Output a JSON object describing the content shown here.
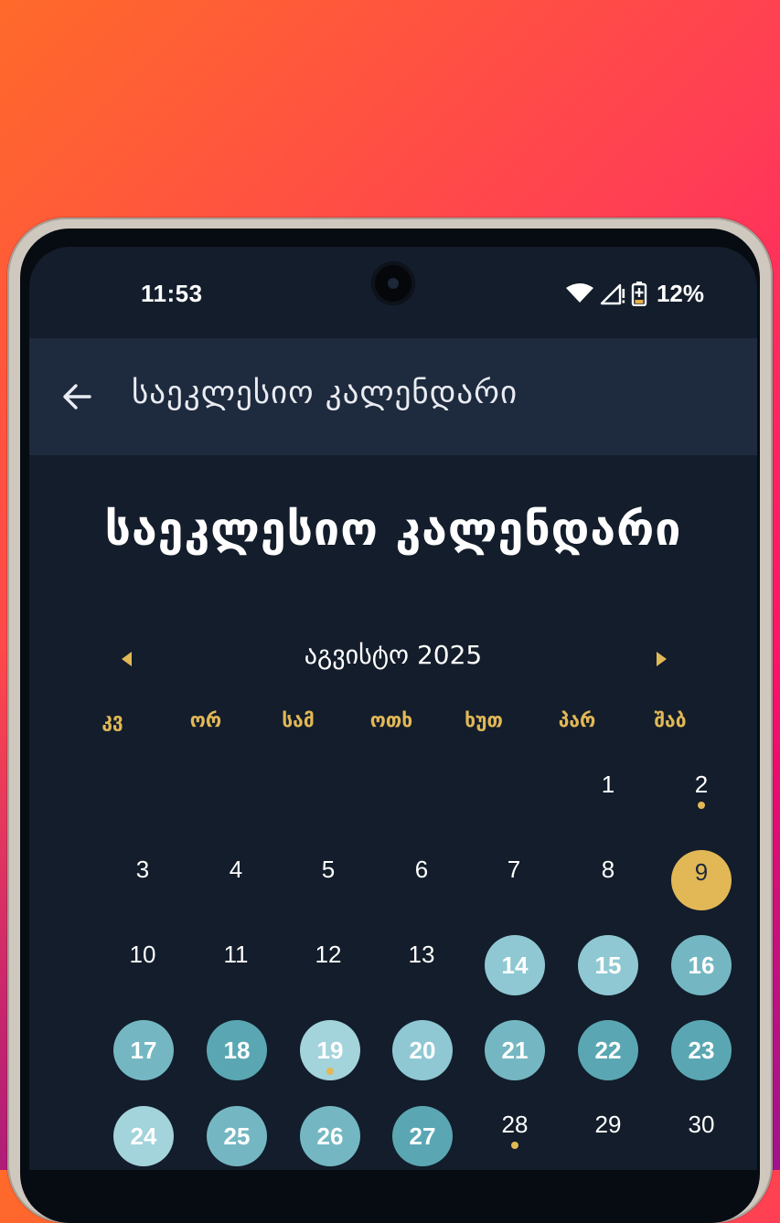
{
  "status_bar": {
    "time": "11:53",
    "battery": "12%",
    "icons": [
      "wifi-icon",
      "cellular-no-signal-icon",
      "battery-charging-icon"
    ]
  },
  "app_bar": {
    "back_icon": "arrow-left-icon",
    "title": "საეკლესიო კალენდარი"
  },
  "page": {
    "title": "საეკლესიო კალენდარი"
  },
  "calendar": {
    "month_label": "აგვისტო 2025",
    "prev_icon": "caret-left-icon",
    "next_icon": "caret-right-icon",
    "weekdays": [
      "კვ",
      "ორ",
      "სამ",
      "ოთხ",
      "ხუთ",
      "პარ",
      "შაბ"
    ],
    "days": [
      "1",
      "2",
      "3",
      "4",
      "5",
      "6",
      "7",
      "8",
      "9",
      "10",
      "11",
      "12",
      "13",
      "14",
      "15",
      "16",
      "17",
      "18",
      "19",
      "20",
      "21",
      "22",
      "23",
      "24",
      "25",
      "26",
      "27",
      "28",
      "29",
      "30"
    ],
    "selected_day": "9",
    "days_with_events": [
      "2",
      "19",
      "28"
    ]
  },
  "colors": {
    "background_gradient": [
      "#ff6a2a",
      "#ff0a6c"
    ],
    "screen_bg": "#131d2b",
    "app_bar_bg": "#1e2a3d",
    "accent_gold": "#e2b856",
    "highlight_light": "#8fc8d2",
    "highlight_dark": "#5aa7b3"
  }
}
